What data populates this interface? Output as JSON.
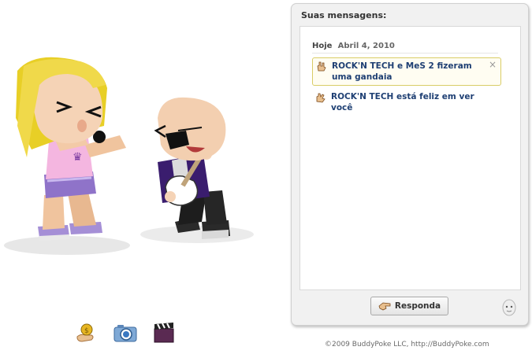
{
  "panel": {
    "title": "Suas mensagens:",
    "day_label": "Hoje",
    "date_label": "Abril 4, 2010",
    "messages": [
      {
        "text": "ROCK'N TECH e MeS 2 fizeram uma gandaia",
        "icon": "rock-hand-icon",
        "highlighted": true,
        "close": "×"
      },
      {
        "text": "ROCK'N TECH está feliz em ver você",
        "icon": "wave-hand-icon",
        "highlighted": false
      }
    ],
    "reply_label": "Responda",
    "reply_icon": "pointing-hand-icon"
  },
  "toolbar": {
    "icons": [
      "coin-hand-icon",
      "camera-icon",
      "clapperboard-icon"
    ]
  },
  "scene": {
    "characters": [
      "blonde-singer-avatar",
      "bald-guitarist-avatar"
    ]
  },
  "footer": {
    "copyright": "©2009 BuddyPoke LLC, http://BuddyPoke.com"
  },
  "colors": {
    "link_text": "#1e3f73",
    "highlight_border": "#d9cc66",
    "panel_bg": "#f1f1f1"
  }
}
